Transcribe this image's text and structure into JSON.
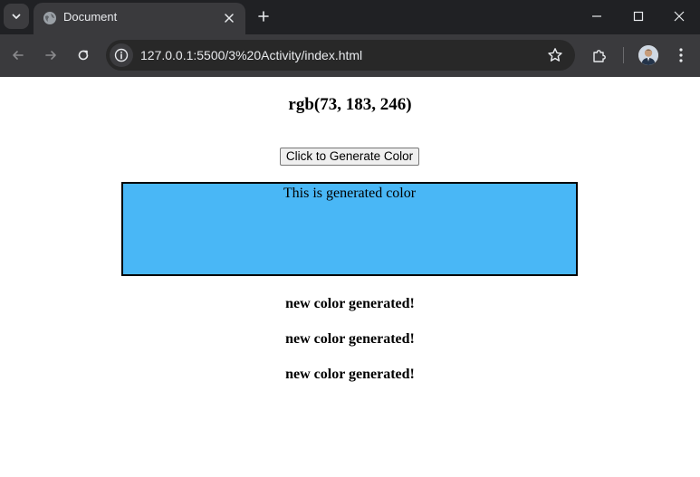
{
  "browser": {
    "tab": {
      "title": "Document"
    },
    "url": "127.0.0.1:5500/3%20Activity/index.html"
  },
  "page": {
    "heading": "rgb(73, 183, 246)",
    "button_label": "Click to Generate Color",
    "box": {
      "text": "This is generated color",
      "color": "#49b7f6"
    },
    "messages": [
      "new color generated!",
      "new color generated!",
      "new color generated!"
    ]
  },
  "colors": {
    "tabbar_bg": "#202124",
    "toolbar_bg": "#3a3a3d",
    "icon": "#e8eaed"
  }
}
